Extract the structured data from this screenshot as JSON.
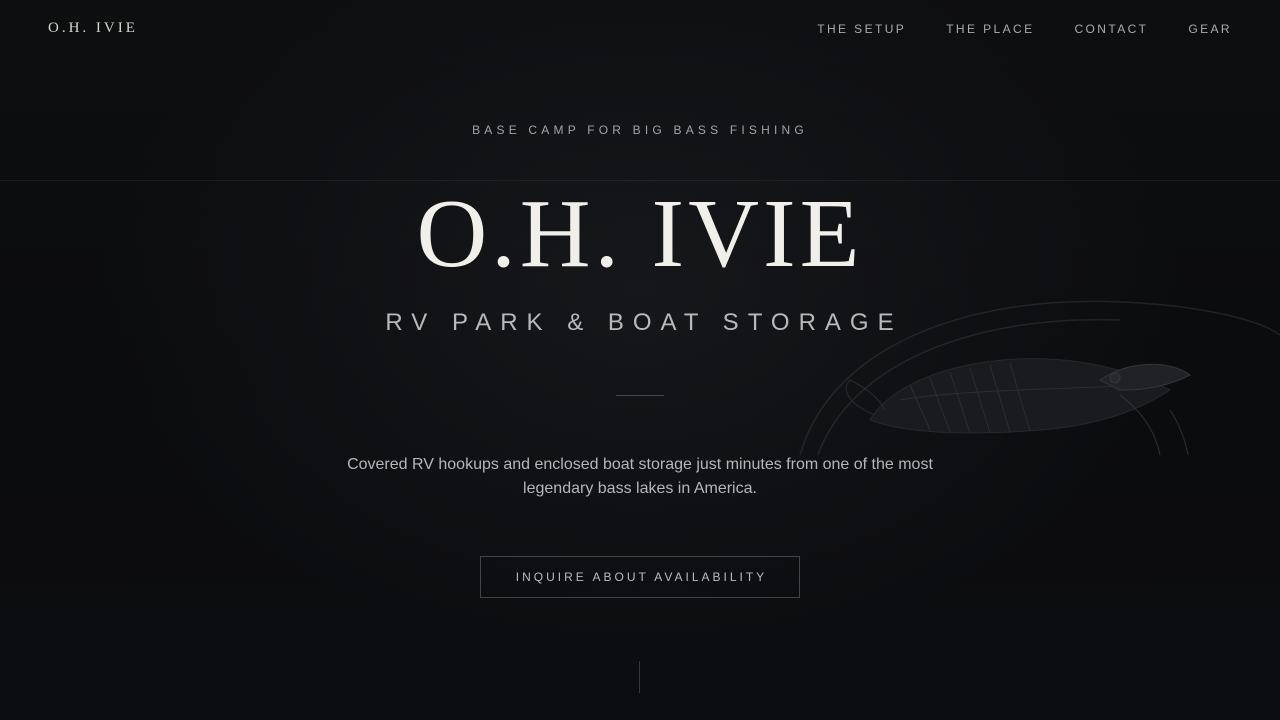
{
  "nav": {
    "logo": "O.H. IVIE",
    "links": [
      {
        "label": "THE SETUP"
      },
      {
        "label": "THE PLACE"
      },
      {
        "label": "CONTACT"
      },
      {
        "label": "GEAR"
      }
    ]
  },
  "hero": {
    "eyebrow": "BASE CAMP FOR BIG BASS FISHING",
    "title": "O.H. IVIE",
    "subtitle": "RV PARK & BOAT STORAGE",
    "description": "Covered RV hookups and enclosed boat storage just minutes from one of the most legendary bass lakes in America.",
    "cta_label": "INQUIRE ABOUT AVAILABILITY"
  },
  "icons": {
    "background_art": "largemouth-bass-illustration"
  },
  "colors": {
    "background": "#0c0d0f",
    "title": "#f1efea",
    "muted_text": "#a9abae",
    "border": "#3a3b3d"
  }
}
